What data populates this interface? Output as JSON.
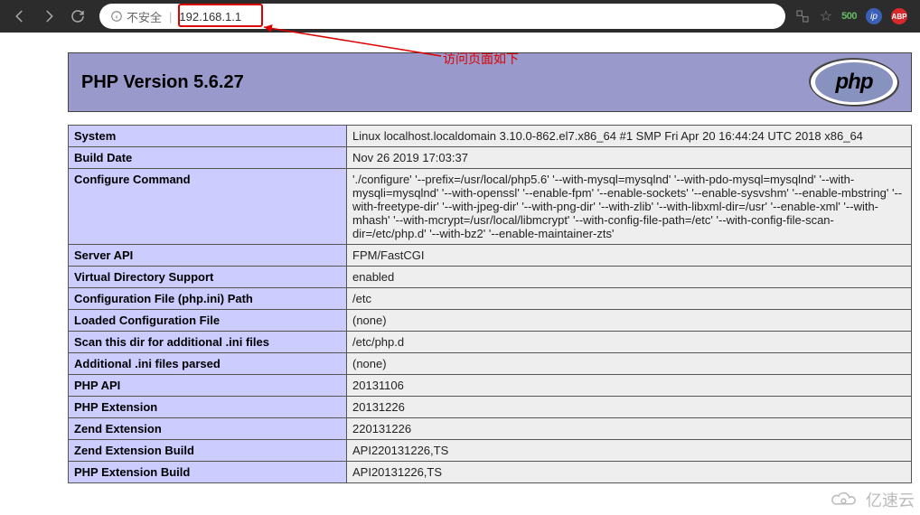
{
  "browser": {
    "insecure_label": "不安全",
    "url": "192.168.1.1",
    "ext_500": "500",
    "ext_ip": "ip",
    "ext_abp": "ABP"
  },
  "annotation": {
    "text": "访问页面如下"
  },
  "header": {
    "title": "PHP Version 5.6.27",
    "logo_text": "php"
  },
  "rows": [
    {
      "k": "System",
      "v": "Linux localhost.localdomain 3.10.0-862.el7.x86_64 #1 SMP Fri Apr 20 16:44:24 UTC 2018 x86_64"
    },
    {
      "k": "Build Date",
      "v": "Nov 26 2019 17:03:37"
    },
    {
      "k": "Configure Command",
      "v": "'./configure' '--prefix=/usr/local/php5.6' '--with-mysql=mysqlnd' '--with-pdo-mysql=mysqlnd' '--with-mysqli=mysqlnd' '--with-openssl' '--enable-fpm' '--enable-sockets' '--enable-sysvshm' '--enable-mbstring' '--with-freetype-dir' '--with-jpeg-dir' '--with-png-dir' '--with-zlib' '--with-libxml-dir=/usr' '--enable-xml' '--with-mhash' '--with-mcrypt=/usr/local/libmcrypt' '--with-config-file-path=/etc' '--with-config-file-scan-dir=/etc/php.d' '--with-bz2' '--enable-maintainer-zts'"
    },
    {
      "k": "Server API",
      "v": "FPM/FastCGI"
    },
    {
      "k": "Virtual Directory Support",
      "v": "enabled"
    },
    {
      "k": "Configuration File (php.ini) Path",
      "v": "/etc"
    },
    {
      "k": "Loaded Configuration File",
      "v": "(none)"
    },
    {
      "k": "Scan this dir for additional .ini files",
      "v": "/etc/php.d"
    },
    {
      "k": "Additional .ini files parsed",
      "v": "(none)"
    },
    {
      "k": "PHP API",
      "v": "20131106"
    },
    {
      "k": "PHP Extension",
      "v": "20131226"
    },
    {
      "k": "Zend Extension",
      "v": "220131226"
    },
    {
      "k": "Zend Extension Build",
      "v": "API220131226,TS"
    },
    {
      "k": "PHP Extension Build",
      "v": "API20131226,TS"
    }
  ],
  "watermark": {
    "text": "亿速云"
  }
}
